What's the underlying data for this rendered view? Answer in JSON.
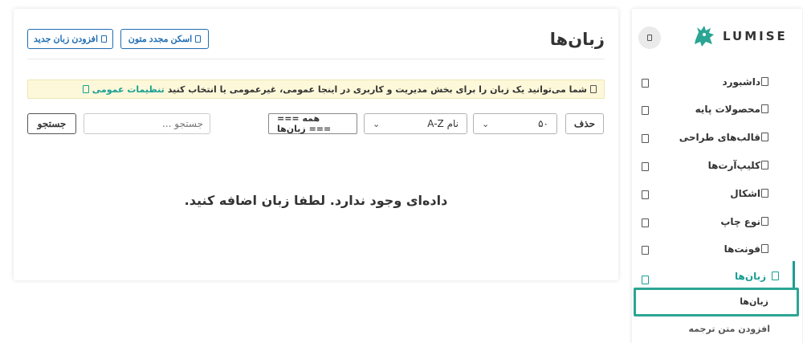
{
  "header": {
    "title": "زبان‌ها",
    "rescan_label": "اسکن مجدد متون",
    "add_language_label": "افزودن زبان جدید"
  },
  "notice": {
    "text": "شما می‌توانید یک زبان را برای بخش مدیریت و کاربری در اینجا عمومی، غیرعمومی یا انتخاب کنید",
    "link_text": "تنظیمات عمومی"
  },
  "toolbar": {
    "delete_label": "حذف",
    "per_page_value": "۵۰",
    "sort_value": "نام A-Z",
    "filter_value": "=== همه زبان‌ها ===",
    "search_placeholder": "جستجو ...",
    "search_button_label": "جستجو"
  },
  "empty_message": "داده‌ای وجود ندارد. لطفا زبان اضافه کنید.",
  "sidebar": {
    "logo_text": "LUMISE",
    "items": [
      {
        "label": "داشبورد"
      },
      {
        "label": "محصولات پایه"
      },
      {
        "label": "قالب‌های طراحی"
      },
      {
        "label": "کلیپ‌آرت‌ها"
      },
      {
        "label": "اشکال"
      },
      {
        "label": "نوع چاپ"
      },
      {
        "label": "فونت‌ها"
      },
      {
        "label": "زبان‌ها"
      }
    ],
    "submenu": [
      {
        "label": "زبان‌ها"
      },
      {
        "label": "افزودن متن ترجمه"
      }
    ]
  },
  "colors": {
    "accent": "#1a9e93",
    "primary_button": "#1f6eb3",
    "notice_bg": "#fdf8d9"
  }
}
